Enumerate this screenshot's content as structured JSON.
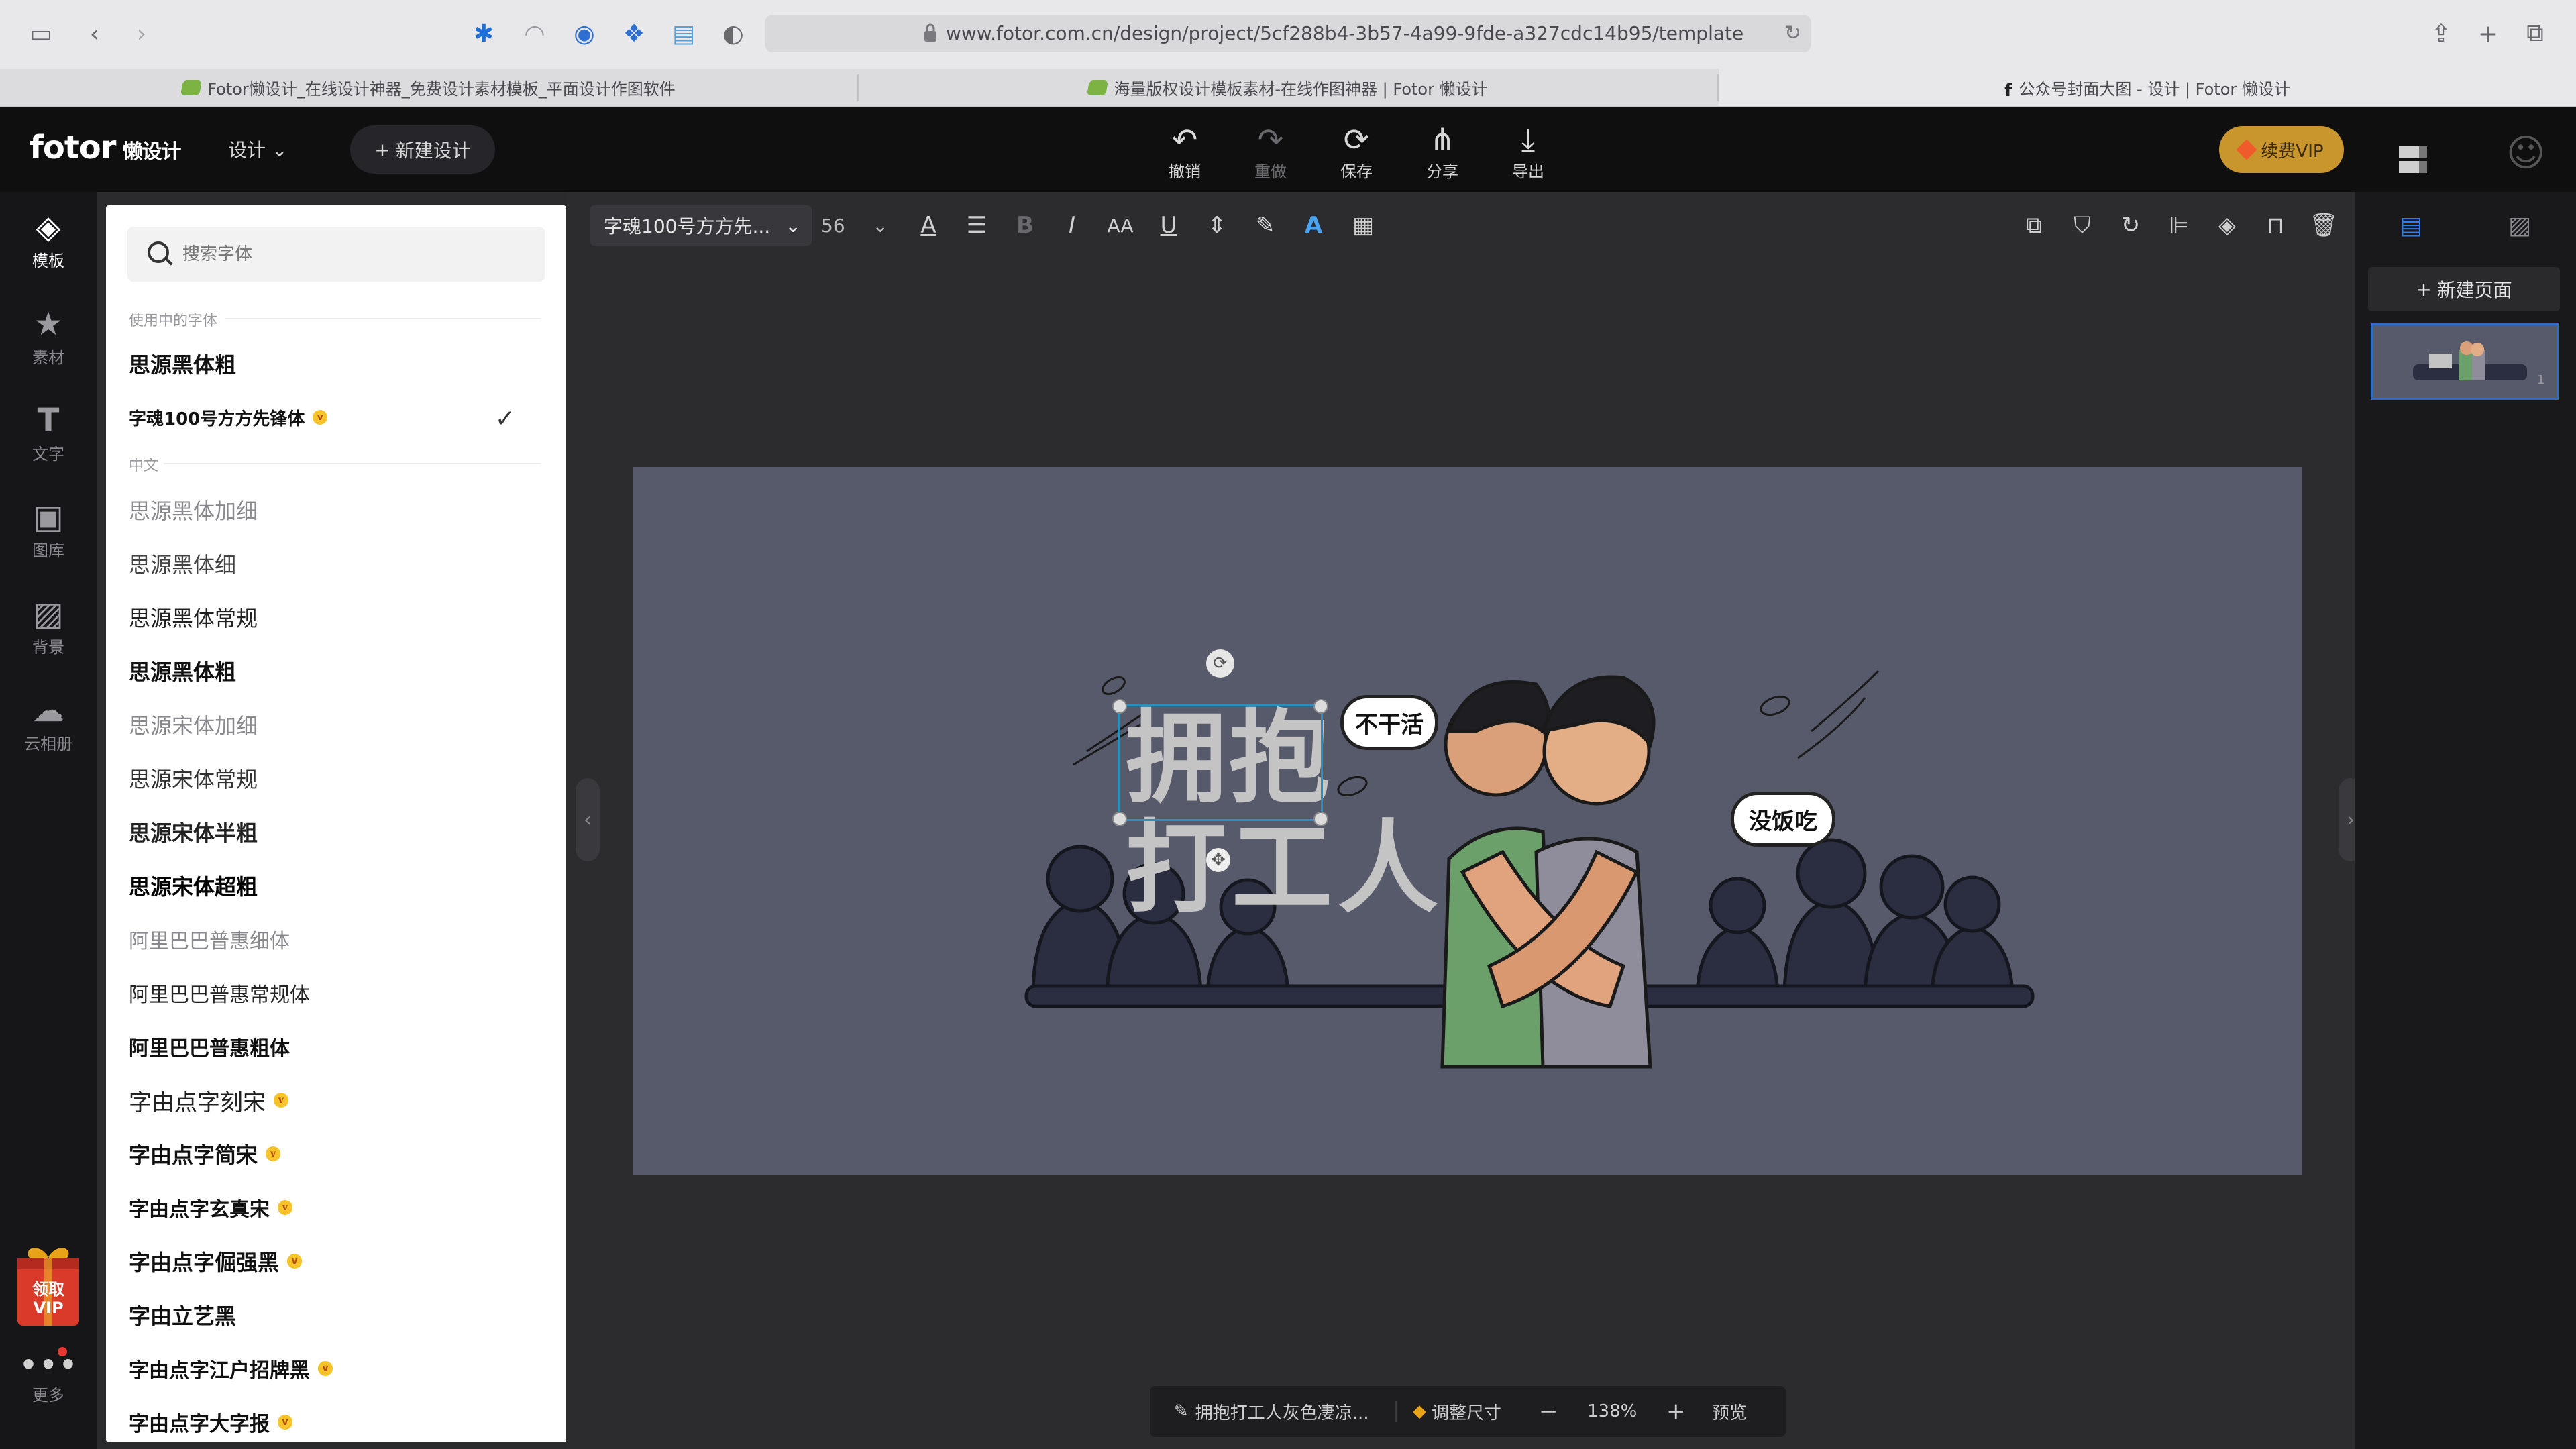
{
  "browser": {
    "url": "www.fotor.com.cn/design/project/5cf288b4-3b57-4a99-9fde-a327cdc14b95/template",
    "tabs": [
      {
        "title": "Fotor懒设计_在线设计神器_免费设计素材模板_平面设计作图软件"
      },
      {
        "title": "海量版权设计模板素材-在线作图神器 | Fotor 懒设计"
      },
      {
        "title": "公众号封面大图 - 设计 | Fotor 懒设计"
      }
    ]
  },
  "header": {
    "logo": "fotor",
    "logo_sub": "懒设计",
    "design_menu": "设计",
    "new_design": "新建设计",
    "tools": [
      {
        "label": "撤销",
        "icon": "undo-icon",
        "glyph": "↶"
      },
      {
        "label": "重做",
        "icon": "redo-icon",
        "glyph": "↷"
      },
      {
        "label": "保存",
        "icon": "save-icon",
        "glyph": "⟳"
      },
      {
        "label": "分享",
        "icon": "share-icon",
        "glyph": "⋔"
      },
      {
        "label": "导出",
        "icon": "download-icon",
        "glyph": "⤓"
      }
    ],
    "vip": "续费VIP"
  },
  "left_rail": {
    "items": [
      {
        "label": "模板",
        "icon": "template-icon",
        "glyph": "◈"
      },
      {
        "label": "素材",
        "icon": "elements-icon",
        "glyph": "★"
      },
      {
        "label": "文字",
        "icon": "text-icon",
        "glyph": "T"
      },
      {
        "label": "图库",
        "icon": "gallery-icon",
        "glyph": "▣"
      },
      {
        "label": "背景",
        "icon": "background-icon",
        "glyph": "▨"
      },
      {
        "label": "云相册",
        "icon": "cloud-icon",
        "glyph": "☁"
      }
    ],
    "gift": "领取\nVIP",
    "more": "更多"
  },
  "font_panel": {
    "search_placeholder": "搜索字体",
    "in_use_label": "使用中的字体",
    "in_use": [
      {
        "name": "思源黑体粗",
        "vip": false,
        "checked": false
      },
      {
        "name": "字魂100号方方先锋体",
        "vip": true,
        "checked": true
      }
    ],
    "chinese_label": "中文",
    "chinese": [
      {
        "name": "思源黑体加细",
        "vip": false
      },
      {
        "name": "思源黑体细",
        "vip": false
      },
      {
        "name": "思源黑体常规",
        "vip": false
      },
      {
        "name": "思源黑体粗",
        "vip": false
      },
      {
        "name": "思源宋体加细",
        "vip": false
      },
      {
        "name": "思源宋体常规",
        "vip": false
      },
      {
        "name": "思源宋体半粗",
        "vip": false
      },
      {
        "name": "思源宋体超粗",
        "vip": false
      },
      {
        "name": "阿里巴巴普惠细体",
        "vip": false
      },
      {
        "name": "阿里巴巴普惠常规体",
        "vip": false
      },
      {
        "name": "阿里巴巴普惠粗体",
        "vip": false
      },
      {
        "name": "字由点字刻宋",
        "vip": true
      },
      {
        "name": "字由点字简宋",
        "vip": true
      },
      {
        "name": "字由点字玄真宋",
        "vip": true
      },
      {
        "name": "字由点字倔强黑",
        "vip": true
      },
      {
        "name": "字由立艺黑",
        "vip": false
      },
      {
        "name": "字由点字江户招牌黑",
        "vip": true
      },
      {
        "name": "字由点字大字报",
        "vip": true
      }
    ]
  },
  "toolbar": {
    "font": "字魂100号方方先...",
    "size": "56",
    "icons": [
      "text-color-icon",
      "align-icon",
      "bold-icon",
      "italic-icon",
      "letter-case-icon",
      "underline-icon",
      "line-spacing-icon",
      "highlight-icon",
      "text-effect-icon",
      "transparency-icon"
    ],
    "right_icons": [
      "copy-icon",
      "stamp-icon",
      "rotate-icon",
      "align-left-icon",
      "layers-icon",
      "lock-icon",
      "delete-icon"
    ]
  },
  "canvas": {
    "text_line1": "拥抱",
    "text_line2": "打工人",
    "bubble1": "不干活",
    "bubble2": "没饭吃",
    "bg_color": "#565a6b"
  },
  "right_panel": {
    "new_page": "新建页面",
    "page_number": "1"
  },
  "bottom_bar": {
    "title": "拥抱打工人灰色凄凉...",
    "resize": "调整尺寸",
    "zoom": "138%",
    "preview": "预览"
  }
}
